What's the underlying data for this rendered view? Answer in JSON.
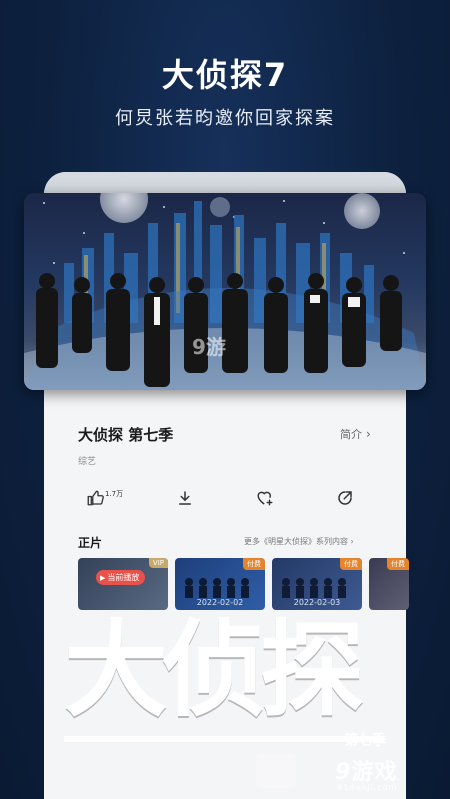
{
  "promo": {
    "title": "大侦探7",
    "subtitle": "何炅张若昀邀你回家探案"
  },
  "poster": {
    "watermark": "9游"
  },
  "details": {
    "show_title": "大侦探 第七季",
    "intro_label": "简介",
    "intro_arrow": "›",
    "genre": "综艺",
    "like_count": "1.7万",
    "icons": [
      "thumbs-up-icon",
      "download-icon",
      "favorite-add-icon",
      "share-icon"
    ]
  },
  "episodes": {
    "section_label": "正片",
    "more_label": "更多《明星大侦探》系列内容 ›",
    "items": [
      {
        "badge": "VIP",
        "now_playing": "当前播放",
        "date": ""
      },
      {
        "badge": "付费",
        "date": "2022-02-02"
      },
      {
        "badge": "付费",
        "date": "2022-02-03"
      },
      {
        "badge": "付费",
        "date": ""
      }
    ]
  },
  "logo": {
    "text": "大侦探",
    "season": "第七季"
  },
  "footer": {
    "watermark_num": "9",
    "watermark_text": "游戏",
    "site": "91danji.com"
  },
  "colors": {
    "background": "#0e2240",
    "accent_red": "#e9524a",
    "paid_orange": "#e4842d",
    "vip_gold": "#c8a86b"
  }
}
